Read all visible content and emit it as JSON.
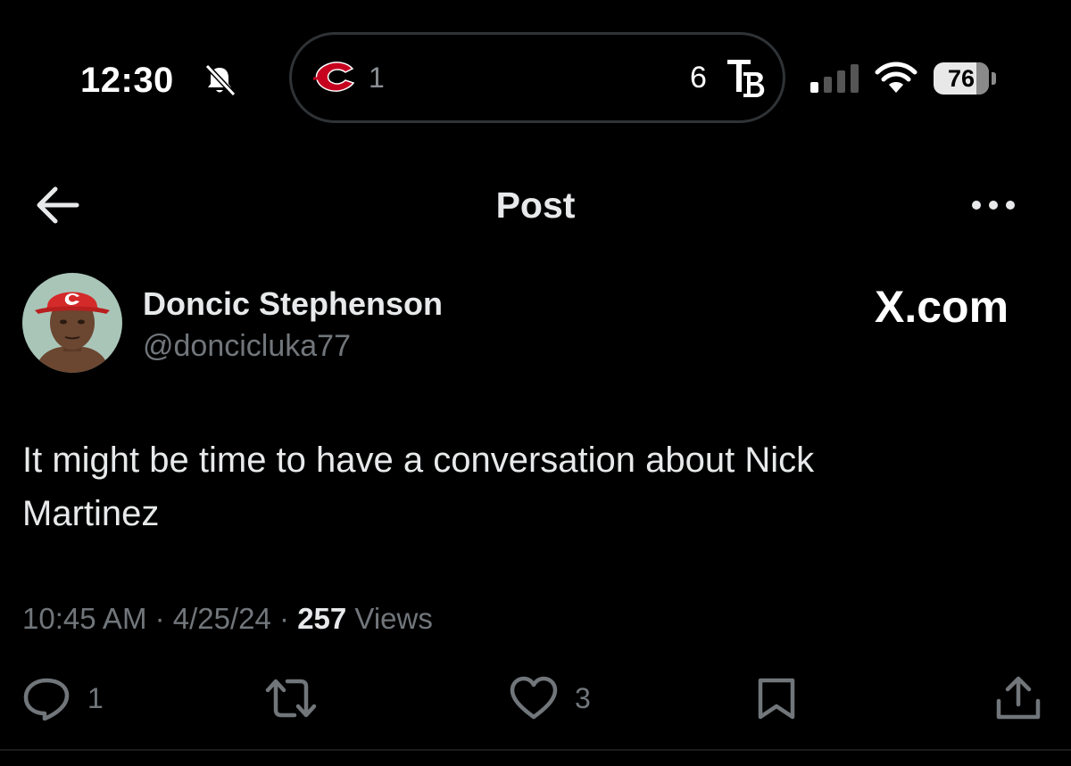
{
  "status_bar": {
    "time": "12:30",
    "live_activity": {
      "away_score": "1",
      "home_score": "6",
      "away_team_icon": "reds-c-logo",
      "home_team_icon": "rays-tb-logo",
      "away_color": "#c6011f"
    },
    "battery": "76",
    "icons": [
      "bell-slash-icon",
      "cellular-signal-icon",
      "wifi-icon",
      "battery-icon"
    ]
  },
  "header": {
    "title": "Post",
    "back_icon": "arrow-left-icon",
    "more_icon": "ellipsis-icon"
  },
  "post": {
    "author": {
      "display_name": "Doncic Stephenson",
      "handle": "@doncicluka77",
      "avatar_icon": "avatar-red-cap"
    },
    "watermark": "X.com",
    "text": "It might be time to have a conversation about Nick\nMartinez",
    "time": "10:45 AM",
    "sep1": " · ",
    "date": "4/25/24",
    "sep2": " · ",
    "views_count": "257",
    "views_label": " Views"
  },
  "actions": {
    "reply_count": "1",
    "like_count": "3",
    "icons": [
      "reply-icon",
      "retweet-icon",
      "heart-icon",
      "bookmark-icon",
      "share-icon"
    ]
  },
  "colors": {
    "background": "#000000",
    "primary_text": "#e7e9ea",
    "secondary_text": "#71767b"
  }
}
